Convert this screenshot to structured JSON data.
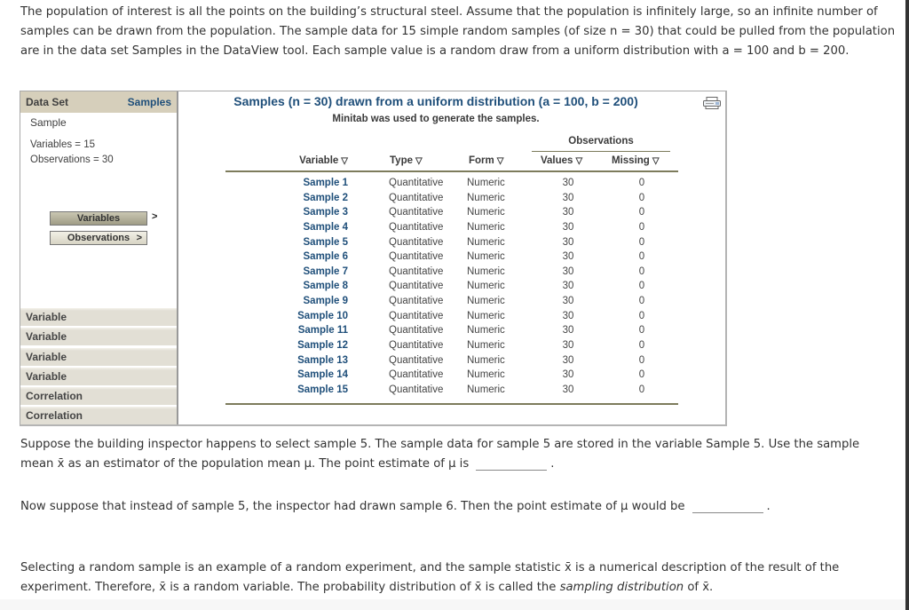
{
  "intro": "The population of interest is all the points on the building’s structural steel. Assume that the population is infinitely large, so an infinite number of samples can be drawn from the population. The sample data for 15 simple random samples (of size n = 30) that could be pulled from the population are in the data set Samples in the DataView tool. Each sample value is a random draw from a uniform distribution with a = 100 and b = 200.",
  "dataview": {
    "sidebar": {
      "header_label": "Data Set",
      "header_value": "Samples",
      "name": "Sample",
      "variables_stat": "Variables = 15",
      "observations_stat": "Observations = 30",
      "variables_button": "Variables",
      "variables_arrow": ">",
      "observations_button": "Observations",
      "observations_arrow": ">",
      "menu_items": [
        "Variable",
        "Variable",
        "Variable",
        "Variable",
        "Correlation",
        "Correlation"
      ]
    },
    "title": "Samples (n = 30) drawn from a uniform distribution (a = 100, b = 200)",
    "subtitle": "Minitab was used to generate the samples.",
    "print_icon": "printer-icon",
    "sort_icon": "▽",
    "observations_group": "Observations",
    "columns": [
      "Variable",
      "Type",
      "Form",
      "Values",
      "Missing"
    ],
    "rows": [
      {
        "variable": "Sample 1",
        "type": "Quantitative",
        "form": "Numeric",
        "values": "30",
        "missing": "0"
      },
      {
        "variable": "Sample 2",
        "type": "Quantitative",
        "form": "Numeric",
        "values": "30",
        "missing": "0"
      },
      {
        "variable": "Sample 3",
        "type": "Quantitative",
        "form": "Numeric",
        "values": "30",
        "missing": "0"
      },
      {
        "variable": "Sample 4",
        "type": "Quantitative",
        "form": "Numeric",
        "values": "30",
        "missing": "0"
      },
      {
        "variable": "Sample 5",
        "type": "Quantitative",
        "form": "Numeric",
        "values": "30",
        "missing": "0"
      },
      {
        "variable": "Sample 6",
        "type": "Quantitative",
        "form": "Numeric",
        "values": "30",
        "missing": "0"
      },
      {
        "variable": "Sample 7",
        "type": "Quantitative",
        "form": "Numeric",
        "values": "30",
        "missing": "0"
      },
      {
        "variable": "Sample 8",
        "type": "Quantitative",
        "form": "Numeric",
        "values": "30",
        "missing": "0"
      },
      {
        "variable": "Sample 9",
        "type": "Quantitative",
        "form": "Numeric",
        "values": "30",
        "missing": "0"
      },
      {
        "variable": "Sample 10",
        "type": "Quantitative",
        "form": "Numeric",
        "values": "30",
        "missing": "0"
      },
      {
        "variable": "Sample 11",
        "type": "Quantitative",
        "form": "Numeric",
        "values": "30",
        "missing": "0"
      },
      {
        "variable": "Sample 12",
        "type": "Quantitative",
        "form": "Numeric",
        "values": "30",
        "missing": "0"
      },
      {
        "variable": "Sample 13",
        "type": "Quantitative",
        "form": "Numeric",
        "values": "30",
        "missing": "0"
      },
      {
        "variable": "Sample 14",
        "type": "Quantitative",
        "form": "Numeric",
        "values": "30",
        "missing": "0"
      },
      {
        "variable": "Sample 15",
        "type": "Quantitative",
        "form": "Numeric",
        "values": "30",
        "missing": "0"
      }
    ]
  },
  "question1": {
    "line": "Suppose the building inspector happens to select sample 5. The sample data for sample 5 are stored in the variable Sample 5. Use the sample mean x̄ as an estimator of the population mean μ. The point estimate of μ is",
    "answer": "",
    "end": "."
  },
  "question2": {
    "line": "Now suppose that instead of sample 5, the inspector had drawn sample 6. Then the point estimate of μ would be",
    "answer": "",
    "end": "."
  },
  "outro": {
    "before": "Selecting a random sample is an example of a random experiment, and the sample statistic x̄ is a numerical description of the result of the experiment. Therefore, x̄ is a random variable. The probability distribution of x̄ is called the ",
    "emphasis": "sampling distribution",
    "after": " of x̄."
  }
}
